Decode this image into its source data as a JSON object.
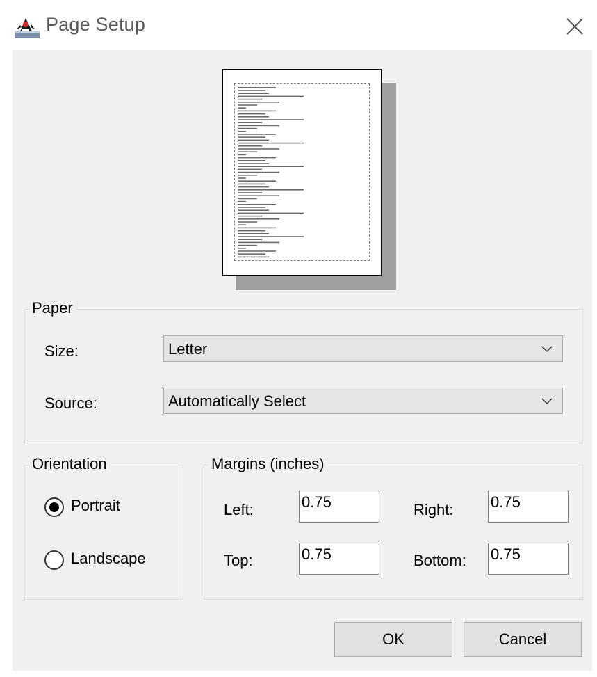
{
  "window": {
    "title": "Page Setup",
    "icon": "java-duke-icon",
    "close_icon": "close-icon"
  },
  "paper": {
    "group_label": "Paper",
    "size_label": "Size:",
    "size_value": "Letter",
    "source_label": "Source:",
    "source_value": "Automatically Select"
  },
  "orientation": {
    "group_label": "Orientation",
    "options": [
      {
        "label": "Portrait",
        "selected": true
      },
      {
        "label": "Landscape",
        "selected": false
      }
    ]
  },
  "margins": {
    "group_label": "Margins (inches)",
    "left_label": "Left:",
    "left_value": "0.75",
    "right_label": "Right:",
    "right_value": "0.75",
    "top_label": "Top:",
    "top_value": "0.75",
    "bottom_label": "Bottom:",
    "bottom_value": "0.75"
  },
  "buttons": {
    "ok_label": "OK",
    "cancel_label": "Cancel"
  }
}
